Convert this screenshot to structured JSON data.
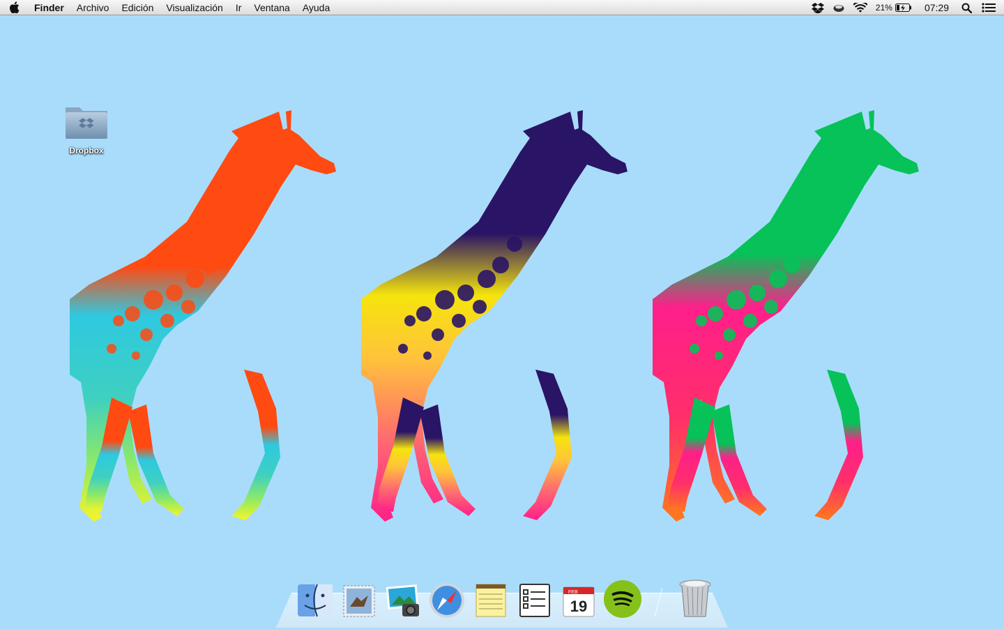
{
  "menubar": {
    "app_name": "Finder",
    "menus": [
      "Archivo",
      "Edición",
      "Visualización",
      "Ir",
      "Ventana",
      "Ayuda"
    ],
    "status": {
      "battery_percent": "21%",
      "clock": "07:29",
      "icons": [
        "dropbox-icon",
        "cloud-app-icon",
        "wifi-icon",
        "battery-charging-icon",
        "spotlight-search-icon",
        "notification-center-icon"
      ]
    }
  },
  "desktop": {
    "icons": [
      {
        "label": "Dropbox",
        "icon": "dropbox-folder-icon"
      }
    ]
  },
  "wallpaper": {
    "background": "#a9dcfb",
    "giraffes": [
      {
        "head": "#ff4a12",
        "body": "#2ec9e0",
        "legs": "#f6f526"
      },
      {
        "head": "#2a1466",
        "body": "#f5e40c",
        "legs": "#ff1f8a"
      },
      {
        "head": "#06c258",
        "body": "#ff1f8a",
        "legs": "#ff7a1a"
      }
    ]
  },
  "dock": {
    "apps": [
      {
        "name": "Finder",
        "icon": "finder-icon"
      },
      {
        "name": "Mail",
        "icon": "mail-icon"
      },
      {
        "name": "iPhoto",
        "icon": "iphoto-icon"
      },
      {
        "name": "Safari",
        "icon": "safari-icon"
      },
      {
        "name": "Notes",
        "icon": "notes-icon"
      },
      {
        "name": "Reminders",
        "icon": "reminders-icon"
      },
      {
        "name": "Calendar",
        "icon": "calendar-icon",
        "month": "FEB",
        "day": "19"
      },
      {
        "name": "Spotify",
        "icon": "spotify-icon"
      }
    ],
    "trash": {
      "name": "Trash",
      "icon": "trash-icon"
    }
  }
}
